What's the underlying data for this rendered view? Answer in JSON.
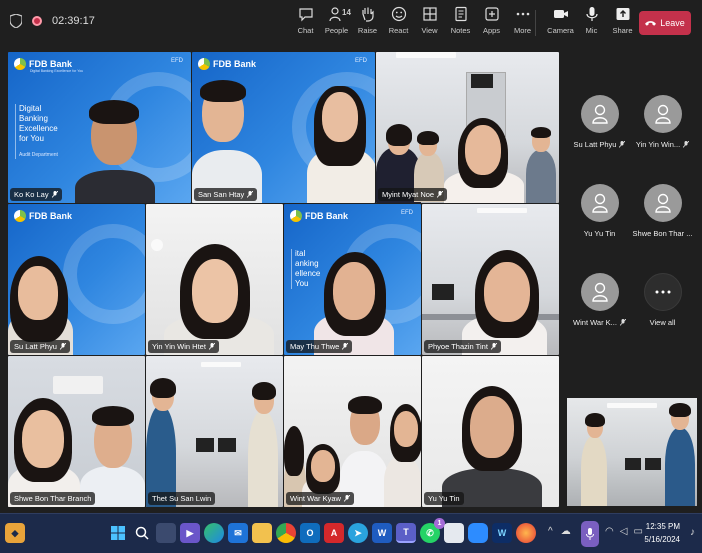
{
  "meeting": {
    "timer": "02:39:17"
  },
  "toolbar": {
    "tools": [
      {
        "id": "chat",
        "label": "Chat",
        "icon": "chat-icon"
      },
      {
        "id": "people",
        "label": "People",
        "icon": "people-icon",
        "count": "14"
      },
      {
        "id": "raise",
        "label": "Raise",
        "icon": "raise-hand-icon"
      },
      {
        "id": "react",
        "label": "React",
        "icon": "react-icon"
      },
      {
        "id": "view",
        "label": "View",
        "icon": "view-icon"
      },
      {
        "id": "notes",
        "label": "Notes",
        "icon": "notes-icon"
      },
      {
        "id": "apps",
        "label": "Apps",
        "icon": "apps-icon"
      },
      {
        "id": "more",
        "label": "More",
        "icon": "more-icon"
      }
    ],
    "media": [
      {
        "id": "camera",
        "label": "Camera",
        "icon": "camera-icon"
      },
      {
        "id": "mic",
        "label": "Mic",
        "icon": "mic-icon"
      },
      {
        "id": "share",
        "label": "Share",
        "icon": "share-icon"
      }
    ],
    "leave_label": "Leave"
  },
  "branding": {
    "bank_name": "FDB Bank",
    "tagline": "Digital Banking Excellence for You",
    "efd": "EFD",
    "slogan_lines": [
      "Digital",
      "Banking",
      "Excellence",
      "for You"
    ],
    "department": "Audit Department",
    "slogan_partial": [
      "ital",
      "anking",
      "ellence",
      "You"
    ]
  },
  "video_tiles": [
    {
      "name": "Ko Ko Lay"
    },
    {
      "name": "San San Htay"
    },
    {
      "name": ""
    },
    {
      "name": "Myint Myat Noe"
    },
    {
      "name": "Su Latt Phyu"
    },
    {
      "name": "Yin Yin Win Htet"
    },
    {
      "name": "May Thu Thwe"
    },
    {
      "name": "Phyoe Thazin Tint"
    },
    {
      "name": "Shwe Bon Thar Branch"
    },
    {
      "name": "Thet Su San Lwin"
    },
    {
      "name": "Wint War Kyaw"
    },
    {
      "name": "Yu Yu Tin"
    }
  ],
  "roster": [
    {
      "name": "Su Latt Phyu"
    },
    {
      "name": "Yin Yin Win..."
    },
    {
      "name": "Yu Yu Tin"
    },
    {
      "name": "Shwe Bon Thar ..."
    },
    {
      "name": "Wint War K..."
    },
    {
      "name": "View all"
    }
  ],
  "taskbar": {
    "time": "12:35 PM",
    "date": "5/16/2024",
    "whatsapp_badge": "1"
  },
  "colors": {
    "leave": "#c4314b",
    "accent": "#7a5fc0",
    "taskbar": "#1c2a4a"
  }
}
